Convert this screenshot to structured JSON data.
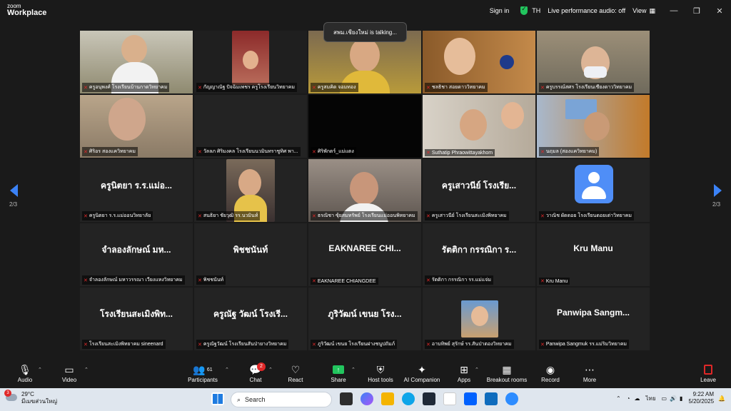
{
  "app": {
    "logo_line1": "zoom",
    "logo_line2": "Workplace",
    "sign_in": "Sign in",
    "lang": "TH",
    "audio_status": "Live performance audio: off",
    "view": "View",
    "talking": "สพม.เชียงใหม่ is talking...",
    "page_left": "2/3",
    "page_right": "2/3"
  },
  "tiles": [
    {
      "label": "ครูอนุพงศ์ โรงเรียนบ้านกาดวิทยาคม",
      "big": "",
      "type": "video"
    },
    {
      "label": "กัญญาณัฐ ปัจฉิมเพชร ครูโรงเรียนวิทยาคม",
      "big": "",
      "type": "video-dark"
    },
    {
      "label": "ครูสมคิด จอมทอง",
      "big": "",
      "type": "video"
    },
    {
      "label": "ชลธิชา สอยดาววิทยาคม",
      "big": "",
      "type": "video"
    },
    {
      "label": "ครูบรรณ์สศร โรงเรียนเชียงดาววิทยาคม",
      "big": "",
      "type": "video"
    },
    {
      "label": "ศิริอร สองแควิทยาคม",
      "big": "",
      "type": "video"
    },
    {
      "label": "วัลลภ ศิริมงคล โรงเรียนนวมินทราชูทิศ พา...",
      "big": "",
      "type": "blank"
    },
    {
      "label": "ศิริพักตร์_แม่แตง",
      "big": "",
      "type": "black"
    },
    {
      "label": "Suthatip Phraowittayakhom",
      "big": "",
      "type": "video"
    },
    {
      "label": "นฤมล (สองแควิทยาคม)",
      "big": "",
      "type": "video"
    },
    {
      "label": "ครูนิตยา ร.ร.แม่ออนวิทยาลัย",
      "big": "ครูนิตยา ร.ร.แม่อ...",
      "type": "name"
    },
    {
      "label": "สนธิยา ชัยวุฒิ รร.นวมินท์",
      "big": "",
      "type": "inset"
    },
    {
      "label": "ธรณิชา ซุ้ยสมทรัพย์ โรงเรียนแม่ออนพิทยาคม",
      "big": "",
      "type": "video"
    },
    {
      "label": "ครูเสาวนีย์ โรงเรียนสะเมิงพิทยาคม",
      "big": "ครูเสาวนีย์ โรงเรีย...",
      "type": "name"
    },
    {
      "label": "วาณิช ผัดดอย โรงเรียนดอยเต่าวิทยาคม",
      "big": "",
      "type": "avatar"
    },
    {
      "label": "จำลองลักษณ์ มหาวรรณา เวียงแหงวิทยาคม",
      "big": "จำลองลักษณ์ มห...",
      "type": "name"
    },
    {
      "label": "พิชชนันท์",
      "big": "พิชชนันท์",
      "type": "name"
    },
    {
      "label": "EAKNAREE CHIANGDEE",
      "big": "EAKNAREE CHI...",
      "type": "name"
    },
    {
      "label": "รัตติกา กรรณิกา รร.แม่แจ่ม",
      "big": "รัตติกา กรรณิกา ร...",
      "type": "name"
    },
    {
      "label": "Kru Manu",
      "big": "Kru Manu",
      "type": "name"
    },
    {
      "label": "โรงเรียนสะเมิงพิทยาคม sineenard",
      "big": "โรงเรียนสะเมิงพิท...",
      "type": "name"
    },
    {
      "label": "ครูณัฐวัฒน์ โรงเรียนสันป่ายางวิทยาคม",
      "big": "ครูณัฐ วัฒน์ โรงเรี...",
      "type": "name"
    },
    {
      "label": "ภูริวัฒน์ เขนย โรงเรียนฝางชนูปถัมภ์",
      "big": "ภูริวัฒน์ เขนย โรง...",
      "type": "name"
    },
    {
      "label": "อาบทิพย์ สุรักษ์ รร.สันป่าตองวิทยาคม",
      "big": "",
      "type": "thumb"
    },
    {
      "label": "Panwipa Sangmuk รร.แม่ริมวิทยาคม",
      "big": "Panwipa Sangm...",
      "type": "name"
    }
  ],
  "toolbar": {
    "audio": "Audio",
    "video": "Video",
    "participants": "Participants",
    "participants_count": "61",
    "chat": "Chat",
    "chat_badge": "2",
    "react": "React",
    "share": "Share",
    "host_tools": "Host tools",
    "ai_companion": "AI Companion",
    "apps": "Apps",
    "breakout": "Breakout rooms",
    "record": "Record",
    "more": "More",
    "leave": "Leave"
  },
  "taskbar": {
    "weather_badge": "3",
    "temp": "29°C",
    "weather_desc": "มีเมฆส่วนใหญ่",
    "search": "Search",
    "lang": "ไทย",
    "time": "9:22 AM",
    "date": "5/20/2025"
  },
  "colors": {
    "accent_green": "#22c55e",
    "mute_red": "#e02828",
    "pager_blue": "#3b82f6",
    "avatar_blue": "#4f8ef7"
  }
}
